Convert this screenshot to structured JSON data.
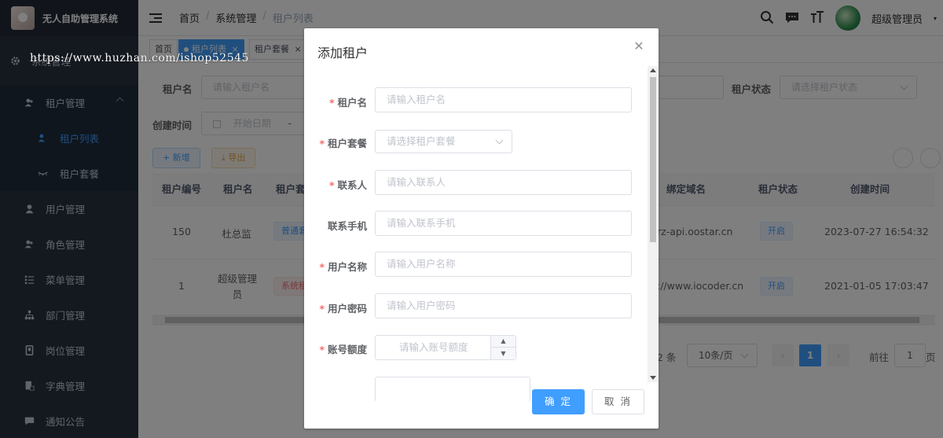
{
  "app": {
    "title": "无人自助管理系统"
  },
  "sidebar": {
    "items": [
      {
        "label": "系统管理",
        "icon": "gear-icon"
      },
      {
        "label": "租户管理",
        "icon": "tenant-icon"
      },
      {
        "label": "租户列表",
        "icon": "list-icon"
      },
      {
        "label": "租户套餐",
        "icon": "package-icon"
      },
      {
        "label": "用户管理",
        "icon": "user-icon"
      },
      {
        "label": "角色管理",
        "icon": "role-icon"
      },
      {
        "label": "菜单管理",
        "icon": "menu-icon"
      },
      {
        "label": "部门管理",
        "icon": "department-icon"
      },
      {
        "label": "岗位管理",
        "icon": "post-icon"
      },
      {
        "label": "字典管理",
        "icon": "dictionary-icon"
      },
      {
        "label": "通知公告",
        "icon": "notice-icon"
      }
    ]
  },
  "header": {
    "breadcrumb": [
      "首页",
      "系统管理",
      "租户列表"
    ],
    "username": "超级管理员"
  },
  "tags": [
    "首页",
    "租户列表",
    "租户套餐"
  ],
  "filters": {
    "tenant_name_label": "租户名",
    "tenant_name_placeholder": "请输入租户名",
    "status_label": "租户状态",
    "status_placeholder": "请选择租户状态",
    "created_label": "创建时间",
    "start_date_placeholder": "开始日期",
    "date_sep": "-",
    "partial_placeholder": "​"
  },
  "toolbar": {
    "add": "+ 新增",
    "export": "⤓ 导出"
  },
  "table": {
    "columns": [
      "租户编号",
      "租户名",
      "租户套",
      "绑定域名",
      "租户状态",
      "创建时间"
    ],
    "rows": [
      {
        "id": "150",
        "name": "杜总监",
        "package": "普通套",
        "domain": "rz-api.oostar.cn",
        "status": "开启",
        "created": "2023-07-27 16:54:32"
      },
      {
        "id": "1",
        "name": "超级管理员",
        "package": "系统租",
        "domain": "://www.iocoder.cn",
        "status": "开启",
        "created": "2021-01-05 17:03:47"
      }
    ]
  },
  "pagination": {
    "total_suffix": "2 条",
    "page_size": "10条/页",
    "current_page": "1",
    "goto_label": "前往",
    "goto_value": "1",
    "page_unit": "页"
  },
  "dialog": {
    "title": "添加租户",
    "fields": [
      {
        "label": "租户名",
        "required": true,
        "placeholder": "请输入租户名"
      },
      {
        "label": "租户套餐",
        "required": true,
        "placeholder": "请选择租户套餐"
      },
      {
        "label": "联系人",
        "required": true,
        "placeholder": "请输入联系人"
      },
      {
        "label": "联系手机",
        "required": false,
        "placeholder": "请输入联系手机"
      },
      {
        "label": "用户名称",
        "required": true,
        "placeholder": "请输入用户名称"
      },
      {
        "label": "用户密码",
        "required": true,
        "placeholder": "请输入用户密码"
      },
      {
        "label": "账号额度",
        "required": true,
        "placeholder": "请输入账号额度"
      }
    ],
    "confirm": "确 定",
    "cancel": "取 消"
  },
  "watermark": "https://www.huzhan.com/ishop52545",
  "colors": {
    "primary": "#409eff",
    "sidebar": "#28303e",
    "danger": "#f56c6c"
  }
}
